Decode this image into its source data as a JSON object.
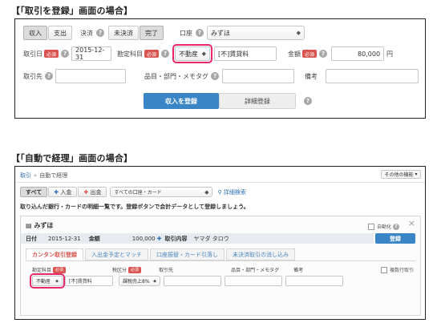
{
  "heading1": "【「取引を登録」画面の場合】",
  "heading2": "【「自動で経理」画面の場合】",
  "form1": {
    "types": [
      "収入",
      "支出"
    ],
    "settle_label": "決済",
    "settle_options": [
      "未決済",
      "完了"
    ],
    "account_label": "口座",
    "account_value": "みずほ",
    "date_label": "取引日",
    "required": "必須",
    "date_value": "2015-12-31",
    "category_label": "勘定科目",
    "category_value": "不動産",
    "category_desc": "[不]賃貸料",
    "amount_label": "金額",
    "amount_value": "80,000",
    "currency": "円",
    "partner_label": "取引先",
    "item_label": "品目・部門・メモタグ",
    "note_label": "備考",
    "submit": "収入を登録",
    "detail": "詳細登録"
  },
  "form2": {
    "breadcrumb_home": "取引",
    "breadcrumb_sep": "»",
    "breadcrumb_current": "自動で経理",
    "other_functions": "その他の機能",
    "filter_all": "すべて",
    "filter_in": "入金",
    "filter_out": "出金",
    "filter_accounts": "すべての口座・カード",
    "detail_search": "詳細検索",
    "description": "取り込んだ銀行・カードの明細一覧です。登録ボタンで会計データとして登録しましょう。",
    "bank_name": "みずほ",
    "auto_label": "自動化",
    "close": "×",
    "date_label": "日付",
    "date_value": "2015-12-31",
    "amount_label": "金額",
    "amount_value": "100,000",
    "content_label": "取引内容",
    "content_value": "ヤマダ タロウ",
    "register": "登録",
    "tabs": [
      "カンタン取引登録",
      "入出金予定とマッチ",
      "口座振替・カード引落し",
      "未決済取引の消し込み"
    ],
    "col_category": "勘定科目",
    "col_tax": "税区分",
    "col_partner": "取引先",
    "col_item": "品目・部門・メモタグ",
    "col_note": "備考",
    "multi_row": "複数行取引",
    "required": "必須",
    "category_value": "不動産",
    "category_desc": "[不]賃貸料",
    "tax_value": "課税売上8%"
  }
}
